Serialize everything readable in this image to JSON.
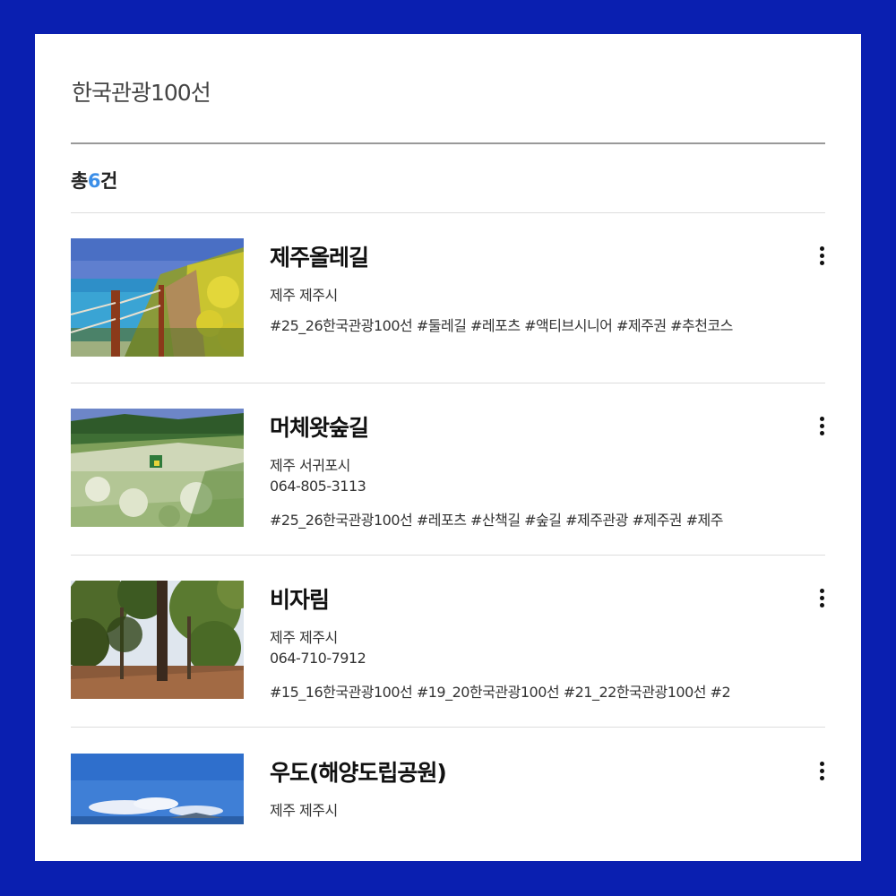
{
  "header": {
    "title": "한국관광100선"
  },
  "summary": {
    "prefix": "총",
    "count": "6",
    "suffix": "건"
  },
  "items": [
    {
      "title": "제주올레길",
      "location": "제주 제주시",
      "phone": "",
      "tags": "#25_26한국관광100선 #둘레길 #레포츠 #액티브시니어 #제주권 #추천코스",
      "image_icon": "coastal-trail-photo"
    },
    {
      "title": "머체왓숲길",
      "location": "제주 서귀포시",
      "phone": "064-805-3113",
      "tags": "#25_26한국관광100선 #레포츠 #산책길 #숲길 #제주관광 #제주권 #제주",
      "image_icon": "forest-meadow-photo"
    },
    {
      "title": "비자림",
      "location": "제주 제주시",
      "phone": "064-710-7912",
      "tags": "#15_16한국관광100선 #19_20한국관광100선 #21_22한국관광100선 #2",
      "image_icon": "forest-photo"
    },
    {
      "title": "우도(해양도립공원)",
      "location": "제주 제주시",
      "phone": "",
      "tags": "",
      "image_icon": "island-sea-photo"
    }
  ],
  "colors": {
    "background": "#0a1fb0",
    "accent": "#3b8ee8"
  }
}
